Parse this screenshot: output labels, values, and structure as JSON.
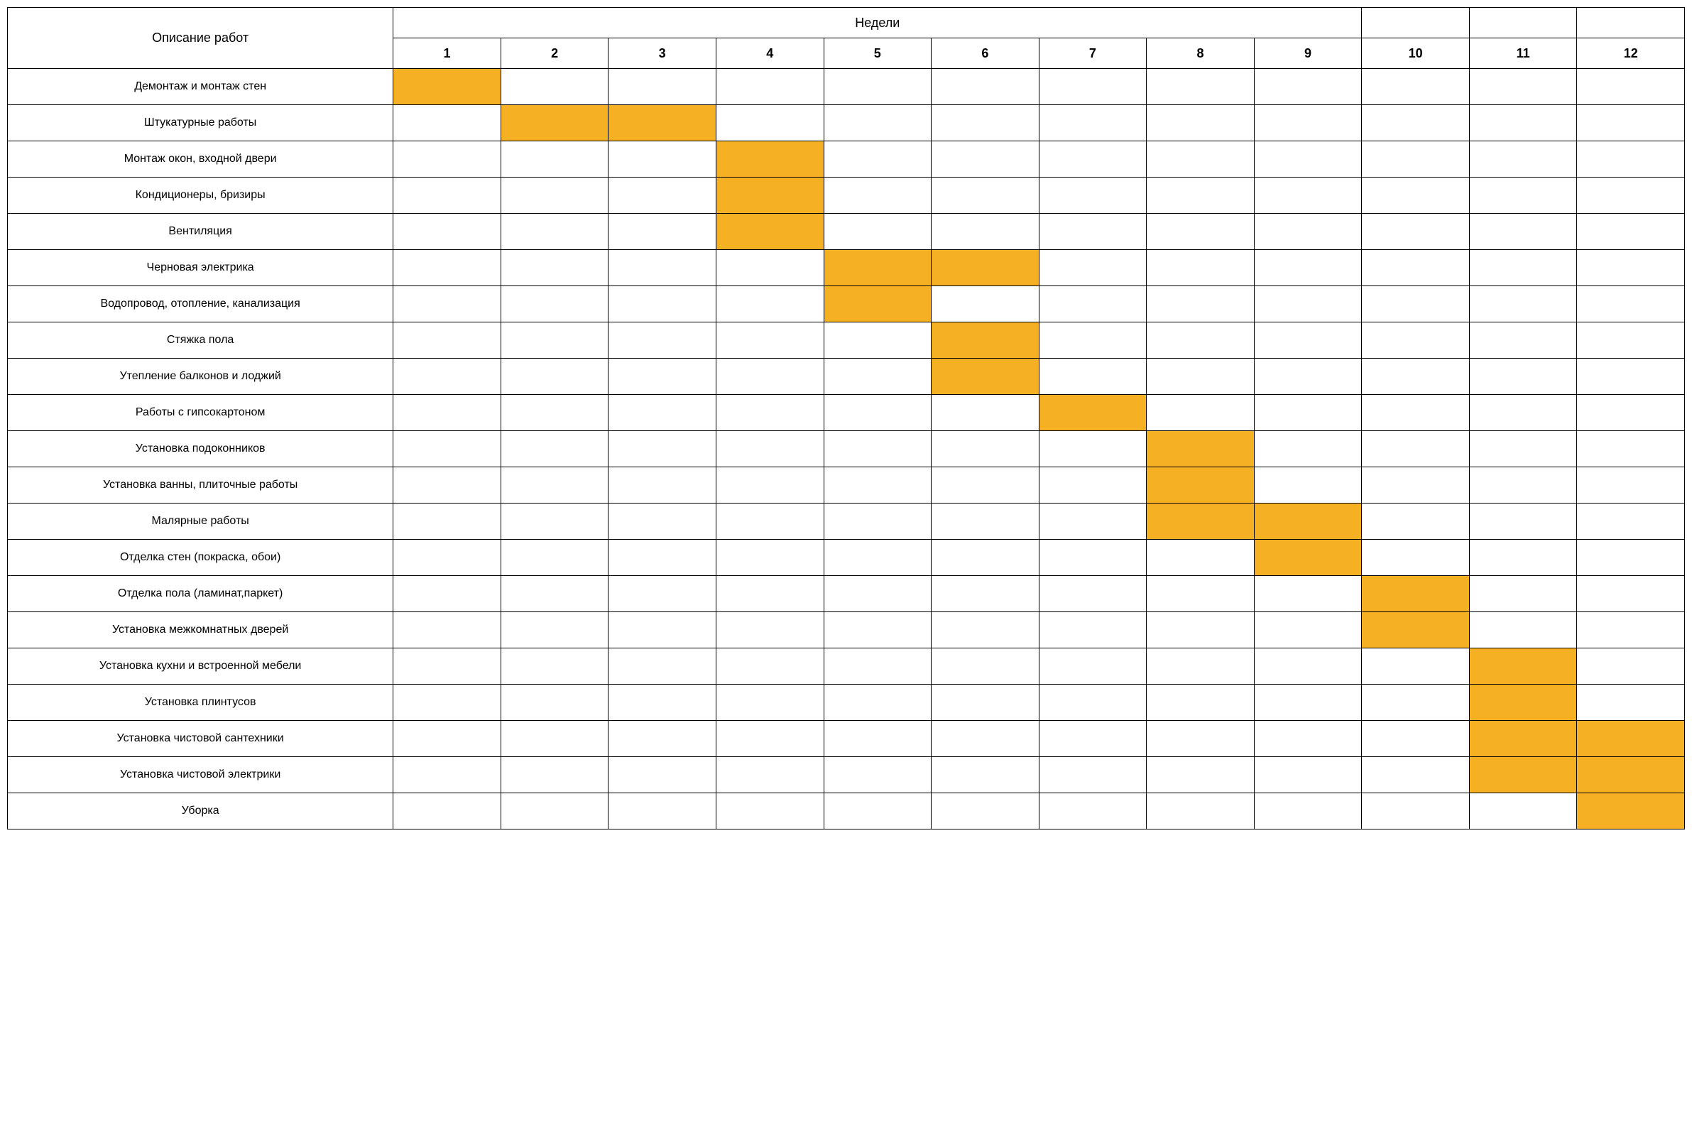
{
  "headers": {
    "task_col": "Описание работ",
    "weeks_header": "Недели",
    "week_numbers": [
      "1",
      "2",
      "3",
      "4",
      "5",
      "6",
      "7",
      "8",
      "9",
      "10",
      "11",
      "12"
    ]
  },
  "colors": {
    "fill": "#f5b024"
  },
  "chart_data": {
    "type": "table",
    "title": "",
    "xlabel": "Недели",
    "ylabel": "Описание работ",
    "categories": [
      "1",
      "2",
      "3",
      "4",
      "5",
      "6",
      "7",
      "8",
      "9",
      "10",
      "11",
      "12"
    ],
    "series": [
      {
        "name": "Демонтаж и монтаж стен",
        "values": [
          1,
          0,
          0,
          0,
          0,
          0,
          0,
          0,
          0,
          0,
          0,
          0
        ]
      },
      {
        "name": "Штукатурные работы",
        "values": [
          0,
          1,
          1,
          0,
          0,
          0,
          0,
          0,
          0,
          0,
          0,
          0
        ]
      },
      {
        "name": "Монтаж окон, входной двери",
        "values": [
          0,
          0,
          0,
          1,
          0,
          0,
          0,
          0,
          0,
          0,
          0,
          0
        ]
      },
      {
        "name": "Кондиционеры, бризиры",
        "values": [
          0,
          0,
          0,
          1,
          0,
          0,
          0,
          0,
          0,
          0,
          0,
          0
        ]
      },
      {
        "name": "Вентиляция",
        "values": [
          0,
          0,
          0,
          1,
          0,
          0,
          0,
          0,
          0,
          0,
          0,
          0
        ]
      },
      {
        "name": "Черновая электрика",
        "values": [
          0,
          0,
          0,
          0,
          1,
          1,
          0,
          0,
          0,
          0,
          0,
          0
        ]
      },
      {
        "name": "Водопровод, отопление, канализация",
        "values": [
          0,
          0,
          0,
          0,
          1,
          0,
          0,
          0,
          0,
          0,
          0,
          0
        ]
      },
      {
        "name": "Стяжка пола",
        "values": [
          0,
          0,
          0,
          0,
          0,
          1,
          0,
          0,
          0,
          0,
          0,
          0
        ]
      },
      {
        "name": "Утепление балконов и лоджий",
        "values": [
          0,
          0,
          0,
          0,
          0,
          1,
          0,
          0,
          0,
          0,
          0,
          0
        ]
      },
      {
        "name": "Работы с гипсокартоном",
        "values": [
          0,
          0,
          0,
          0,
          0,
          0,
          1,
          0,
          0,
          0,
          0,
          0
        ]
      },
      {
        "name": "Установка подоконников",
        "values": [
          0,
          0,
          0,
          0,
          0,
          0,
          0,
          1,
          0,
          0,
          0,
          0
        ]
      },
      {
        "name": "Установка ванны, плиточные работы",
        "values": [
          0,
          0,
          0,
          0,
          0,
          0,
          0,
          1,
          0,
          0,
          0,
          0
        ]
      },
      {
        "name": "Малярные работы",
        "values": [
          0,
          0,
          0,
          0,
          0,
          0,
          0,
          1,
          1,
          0,
          0,
          0
        ]
      },
      {
        "name": "Отделка стен (покраска, обои)",
        "values": [
          0,
          0,
          0,
          0,
          0,
          0,
          0,
          0,
          1,
          0,
          0,
          0
        ]
      },
      {
        "name": "Отделка пола (ламинат,паркет)",
        "values": [
          0,
          0,
          0,
          0,
          0,
          0,
          0,
          0,
          0,
          1,
          0,
          0
        ]
      },
      {
        "name": "Установка межкомнатных дверей",
        "values": [
          0,
          0,
          0,
          0,
          0,
          0,
          0,
          0,
          0,
          1,
          0,
          0
        ]
      },
      {
        "name": "Установка кухни и встроенной мебели",
        "values": [
          0,
          0,
          0,
          0,
          0,
          0,
          0,
          0,
          0,
          0,
          1,
          0
        ]
      },
      {
        "name": "Установка плинтусов",
        "values": [
          0,
          0,
          0,
          0,
          0,
          0,
          0,
          0,
          0,
          0,
          1,
          0
        ]
      },
      {
        "name": "Установка чистовой сантехники",
        "values": [
          0,
          0,
          0,
          0,
          0,
          0,
          0,
          0,
          0,
          0,
          1,
          1
        ]
      },
      {
        "name": "Установка чистовой электрики",
        "values": [
          0,
          0,
          0,
          0,
          0,
          0,
          0,
          0,
          0,
          0,
          1,
          1
        ]
      },
      {
        "name": "Уборка",
        "values": [
          0,
          0,
          0,
          0,
          0,
          0,
          0,
          0,
          0,
          0,
          0,
          1
        ]
      }
    ]
  }
}
